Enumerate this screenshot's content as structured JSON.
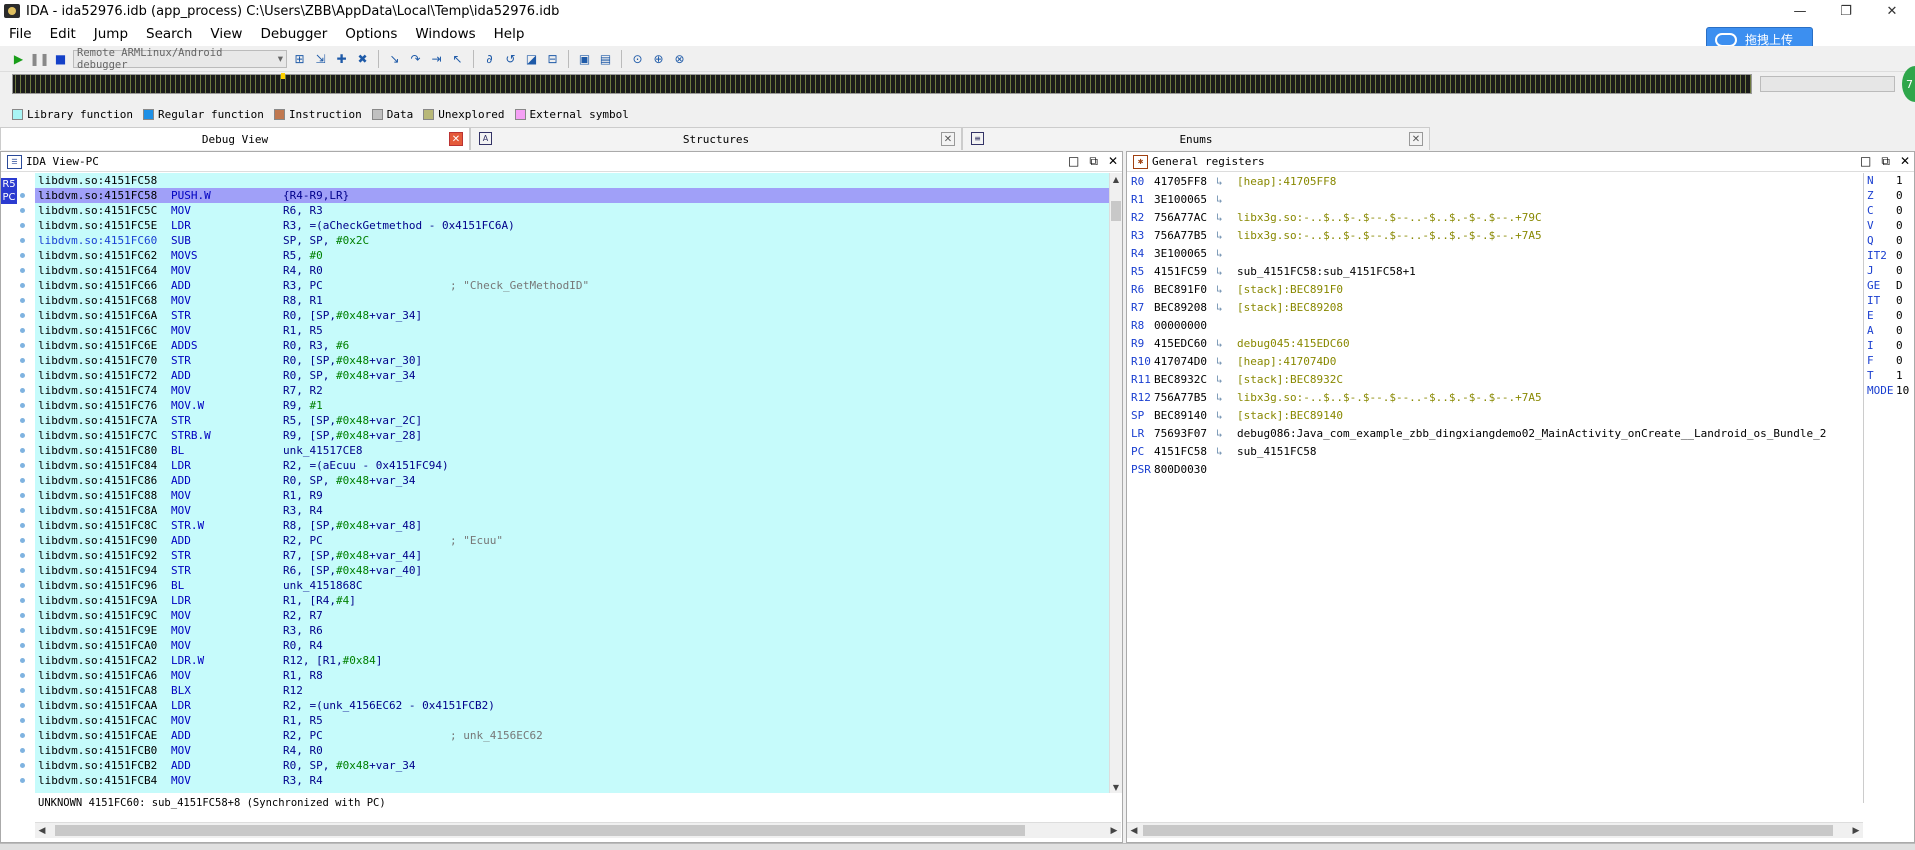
{
  "window": {
    "title": "IDA - ida52976.idb (app_process) C:\\Users\\ZBB\\AppData\\Local\\Temp\\ida52976.idb",
    "min": "—",
    "restore": "❐",
    "close": "✕"
  },
  "menu": [
    "File",
    "Edit",
    "Jump",
    "Search",
    "View",
    "Debugger",
    "Options",
    "Windows",
    "Help"
  ],
  "cloud_button": {
    "label": "拖拽上传"
  },
  "toolbar": {
    "debugger_select": "Remote ARMLinux/Android debugger"
  },
  "navband": {
    "badge": "7"
  },
  "legend": [
    {
      "label": "Library function",
      "color": "#a8f5f5"
    },
    {
      "label": "Regular function",
      "color": "#1e90e6"
    },
    {
      "label": "Instruction",
      "color": "#c07850"
    },
    {
      "label": "Data",
      "color": "#c0c0c0"
    },
    {
      "label": "Unexplored",
      "color": "#b8b878"
    },
    {
      "label": "External symbol",
      "color": "#f5a0f5"
    }
  ],
  "tabs": [
    {
      "label": "Debug View",
      "close": "✕"
    },
    {
      "label": "Structures",
      "icon": "A",
      "close": "✕"
    },
    {
      "label": "Enums",
      "icon": "≡",
      "close": "✕"
    }
  ],
  "ida_view": {
    "title": "IDA View-PC",
    "badges": [
      "R5",
      "PC"
    ],
    "status": "UNKNOWN 4151FC60: sub_4151FC58+8 (Synchronized with PC)",
    "rows": [
      {
        "addr": "libdvm.so:4151FC58",
        "mn": "",
        "op": "",
        "cm": ""
      },
      {
        "addr": "libdvm.so:4151FC58",
        "mn": "PUSH.W",
        "op": "{R4-R9,LR}",
        "cm": ""
      },
      {
        "addr": "libdvm.so:4151FC5C",
        "mn": "MOV",
        "op": "R6, R3",
        "cm": ""
      },
      {
        "addr": "libdvm.so:4151FC5E",
        "mn": "LDR",
        "op": "R3, =(aCheckGetmethod - 0x4151FC6A)",
        "cm": ""
      },
      {
        "addr": "libdvm.so:4151FC60",
        "mn": "SUB",
        "op": "SP, SP, #0x2C",
        "cm": ""
      },
      {
        "addr": "libdvm.so:4151FC62",
        "mn": "MOVS",
        "op": "R5, #0",
        "cm": ""
      },
      {
        "addr": "libdvm.so:4151FC64",
        "mn": "MOV",
        "op": "R4, R0",
        "cm": ""
      },
      {
        "addr": "libdvm.so:4151FC66",
        "mn": "ADD",
        "op": "R3, PC",
        "cm": "; \"Check_GetMethodID\""
      },
      {
        "addr": "libdvm.so:4151FC68",
        "mn": "MOV",
        "op": "R8, R1",
        "cm": ""
      },
      {
        "addr": "libdvm.so:4151FC6A",
        "mn": "STR",
        "op": "R0, [SP,#0x48+var_34]",
        "cm": ""
      },
      {
        "addr": "libdvm.so:4151FC6C",
        "mn": "MOV",
        "op": "R1, R5",
        "cm": ""
      },
      {
        "addr": "libdvm.so:4151FC6E",
        "mn": "ADDS",
        "op": "R0, R3, #6",
        "cm": ""
      },
      {
        "addr": "libdvm.so:4151FC70",
        "mn": "STR",
        "op": "R0, [SP,#0x48+var_30]",
        "cm": ""
      },
      {
        "addr": "libdvm.so:4151FC72",
        "mn": "ADD",
        "op": "R0, SP, #0x48+var_34",
        "cm": ""
      },
      {
        "addr": "libdvm.so:4151FC74",
        "mn": "MOV",
        "op": "R7, R2",
        "cm": ""
      },
      {
        "addr": "libdvm.so:4151FC76",
        "mn": "MOV.W",
        "op": "R9, #1",
        "cm": ""
      },
      {
        "addr": "libdvm.so:4151FC7A",
        "mn": "STR",
        "op": "R5, [SP,#0x48+var_2C]",
        "cm": ""
      },
      {
        "addr": "libdvm.so:4151FC7C",
        "mn": "STRB.W",
        "op": "R9, [SP,#0x48+var_28]",
        "cm": ""
      },
      {
        "addr": "libdvm.so:4151FC80",
        "mn": "BL",
        "op": "unk_41517CE8",
        "cm": ""
      },
      {
        "addr": "libdvm.so:4151FC84",
        "mn": "LDR",
        "op": "R2, =(aEcuu - 0x4151FC94)",
        "cm": ""
      },
      {
        "addr": "libdvm.so:4151FC86",
        "mn": "ADD",
        "op": "R0, SP, #0x48+var_34",
        "cm": ""
      },
      {
        "addr": "libdvm.so:4151FC88",
        "mn": "MOV",
        "op": "R1, R9",
        "cm": ""
      },
      {
        "addr": "libdvm.so:4151FC8A",
        "mn": "MOV",
        "op": "R3, R4",
        "cm": ""
      },
      {
        "addr": "libdvm.so:4151FC8C",
        "mn": "STR.W",
        "op": "R8, [SP,#0x48+var_48]",
        "cm": ""
      },
      {
        "addr": "libdvm.so:4151FC90",
        "mn": "ADD",
        "op": "R2, PC",
        "cm": "; \"Ecuu\""
      },
      {
        "addr": "libdvm.so:4151FC92",
        "mn": "STR",
        "op": "R7, [SP,#0x48+var_44]",
        "cm": ""
      },
      {
        "addr": "libdvm.so:4151FC94",
        "mn": "STR",
        "op": "R6, [SP,#0x48+var_40]",
        "cm": ""
      },
      {
        "addr": "libdvm.so:4151FC96",
        "mn": "BL",
        "op": "unk_4151868C",
        "cm": ""
      },
      {
        "addr": "libdvm.so:4151FC9A",
        "mn": "LDR",
        "op": "R1, [R4,#4]",
        "cm": ""
      },
      {
        "addr": "libdvm.so:4151FC9C",
        "mn": "MOV",
        "op": "R2, R7",
        "cm": ""
      },
      {
        "addr": "libdvm.so:4151FC9E",
        "mn": "MOV",
        "op": "R3, R6",
        "cm": ""
      },
      {
        "addr": "libdvm.so:4151FCA0",
        "mn": "MOV",
        "op": "R0, R4",
        "cm": ""
      },
      {
        "addr": "libdvm.so:4151FCA2",
        "mn": "LDR.W",
        "op": "R12, [R1,#0x84]",
        "cm": ""
      },
      {
        "addr": "libdvm.so:4151FCA6",
        "mn": "MOV",
        "op": "R1, R8",
        "cm": ""
      },
      {
        "addr": "libdvm.so:4151FCA8",
        "mn": "BLX",
        "op": "R12",
        "cm": ""
      },
      {
        "addr": "libdvm.so:4151FCAA",
        "mn": "LDR",
        "op": "R2, =(unk_4156EC62 - 0x4151FCB2)",
        "cm": ""
      },
      {
        "addr": "libdvm.so:4151FCAC",
        "mn": "MOV",
        "op": "R1, R5",
        "cm": ""
      },
      {
        "addr": "libdvm.so:4151FCAE",
        "mn": "ADD",
        "op": "R2, PC",
        "cm": "; unk_4156EC62"
      },
      {
        "addr": "libdvm.so:4151FCB0",
        "mn": "MOV",
        "op": "R4, R0",
        "cm": ""
      },
      {
        "addr": "libdvm.so:4151FCB2",
        "mn": "ADD",
        "op": "R0, SP, #0x48+var_34",
        "cm": ""
      },
      {
        "addr": "libdvm.so:4151FCB4",
        "mn": "MOV",
        "op": "R3, R4",
        "cm": ""
      }
    ]
  },
  "registers": {
    "title": "General registers",
    "rows": [
      {
        "name": "R0",
        "value": "41705FF8",
        "desc": "[heap]:41705FF8"
      },
      {
        "name": "R1",
        "value": "3E100065",
        "desc": ""
      },
      {
        "name": "R2",
        "value": "756A77AC",
        "desc": "libx3g.so:-..$..$-.$--.$--..-$..$.-$-.$--.+79C"
      },
      {
        "name": "R3",
        "value": "756A77B5",
        "desc": "libx3g.so:-..$..$-.$--.$--..-$..$.-$-.$--.+7A5"
      },
      {
        "name": "R4",
        "value": "3E100065",
        "desc": ""
      },
      {
        "name": "R5",
        "value": "4151FC59",
        "desc": "sub_4151FC58:sub_4151FC58+1"
      },
      {
        "name": "R6",
        "value": "BEC891F0",
        "desc": "[stack]:BEC891F0"
      },
      {
        "name": "R7",
        "value": "BEC89208",
        "desc": "[stack]:BEC89208"
      },
      {
        "name": "R8",
        "value": "00000000",
        "desc": ""
      },
      {
        "name": "R9",
        "value": "415EDC60",
        "desc": "debug045:415EDC60"
      },
      {
        "name": "R10",
        "value": "417074D0",
        "desc": "[heap]:417074D0"
      },
      {
        "name": "R11",
        "value": "BEC8932C",
        "desc": "[stack]:BEC8932C"
      },
      {
        "name": "R12",
        "value": "756A77B5",
        "desc": "libx3g.so:-..$..$-.$--.$--..-$..$.-$-.$--.+7A5"
      },
      {
        "name": "SP",
        "value": "BEC89140",
        "desc": "[stack]:BEC89140"
      },
      {
        "name": "LR",
        "value": "75693F07",
        "desc": "debug086:Java_com_example_zbb_dingxiangdemo02_MainActivity_onCreate__Landroid_os_Bundle_2"
      },
      {
        "name": "PC",
        "value": "4151FC58",
        "desc": "sub_4151FC58"
      },
      {
        "name": "PSR",
        "value": "800D0030",
        "desc": ""
      }
    ],
    "flags": [
      {
        "name": "N",
        "value": "1"
      },
      {
        "name": "Z",
        "value": "0"
      },
      {
        "name": "C",
        "value": "0"
      },
      {
        "name": "V",
        "value": "0"
      },
      {
        "name": "Q",
        "value": "0"
      },
      {
        "name": "IT2",
        "value": "0"
      },
      {
        "name": "J",
        "value": "0"
      },
      {
        "name": "GE",
        "value": "D"
      },
      {
        "name": "IT",
        "value": "0"
      },
      {
        "name": "E",
        "value": "0"
      },
      {
        "name": "A",
        "value": "0"
      },
      {
        "name": "I",
        "value": "0"
      },
      {
        "name": "F",
        "value": "0"
      },
      {
        "name": "T",
        "value": "1"
      },
      {
        "name": "MODE",
        "value": "10"
      }
    ]
  }
}
